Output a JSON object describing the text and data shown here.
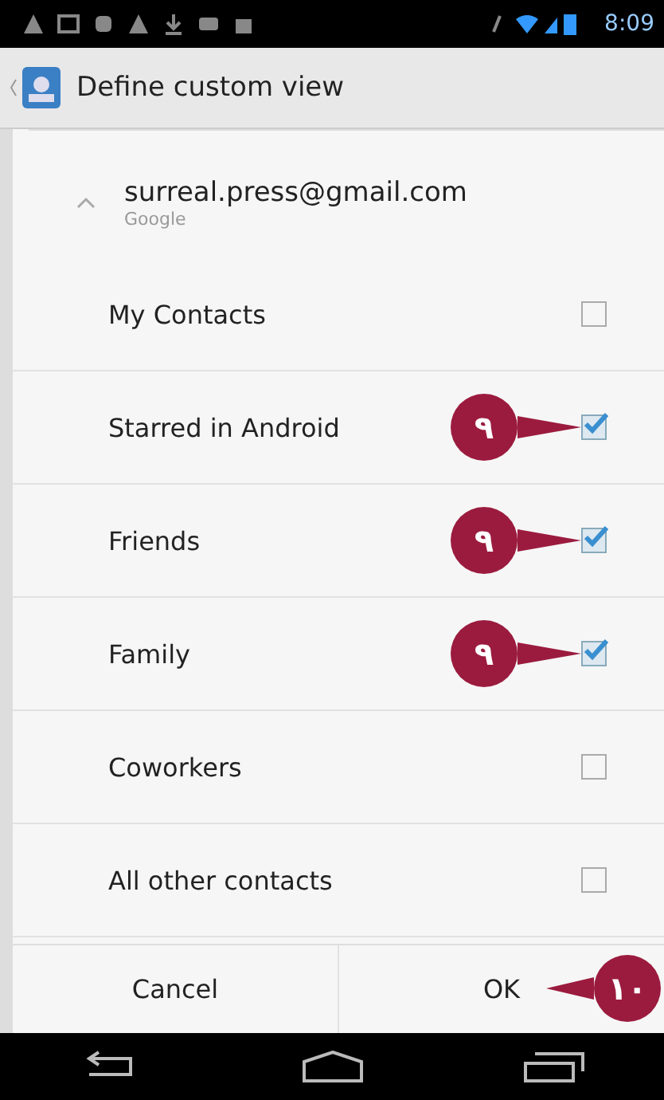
{
  "status_bar": {
    "time": "8:09"
  },
  "title_bar": {
    "title": "Define custom view"
  },
  "account": {
    "email": "surreal.press@gmail.com",
    "type": "Google",
    "expanded": true
  },
  "groups": [
    {
      "label": "My Contacts",
      "checked": false
    },
    {
      "label": "Starred in Android",
      "checked": true,
      "callout": "٩"
    },
    {
      "label": "Friends",
      "checked": true,
      "callout": "٩"
    },
    {
      "label": "Family",
      "checked": true,
      "callout": "٩"
    },
    {
      "label": "Coworkers",
      "checked": false
    },
    {
      "label": "All other contacts",
      "checked": false
    }
  ],
  "buttons": [
    {
      "label": "Cancel"
    },
    {
      "label": "OK",
      "callout": "١٠"
    }
  ]
}
